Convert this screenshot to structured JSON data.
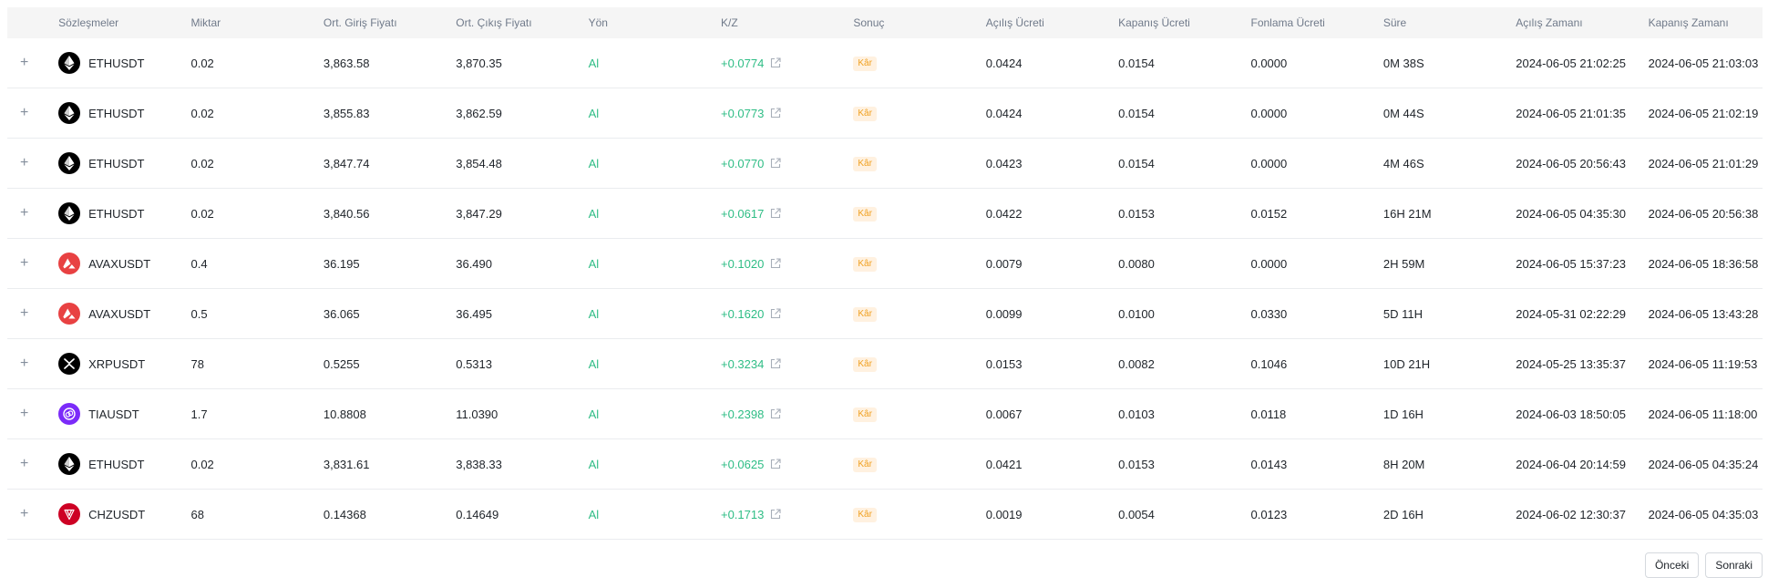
{
  "headers": [
    "Sözleşmeler",
    "Miktar",
    "Ort. Giriş Fiyatı",
    "Ort. Çıkış Fiyatı",
    "Yön",
    "K/Z",
    "Sonuç",
    "Açılış Ücreti",
    "Kapanış Ücreti",
    "Fonlama Ücreti",
    "Süre",
    "Açılış Zamanı",
    "Kapanış Zamanı"
  ],
  "coin_styles": {
    "ETH": {
      "bg": "#000000",
      "icon": "ethereum-icon"
    },
    "AVAX": {
      "bg": "#e84142",
      "icon": "avalanche-icon"
    },
    "XRP": {
      "bg": "#000000",
      "icon": "xrp-icon"
    },
    "TIA": {
      "bg": "#7b2bf9",
      "icon": "celestia-icon"
    },
    "CHZ": {
      "bg": "#cd0124",
      "icon": "chiliz-icon"
    }
  },
  "rows": [
    {
      "coin": "ETH",
      "symbol": "ETHUSDT",
      "qty": "0.02",
      "entry": "3,863.58",
      "exit": "3,870.35",
      "side": "Al",
      "pnl": "+0.0774",
      "result": "Kâr",
      "open_fee": "0.0424",
      "close_fee": "0.0154",
      "funding_fee": "0.0000",
      "duration": "0M 38S",
      "open_time": "2024-06-05 21:02:25",
      "close_time": "2024-06-05 21:03:03"
    },
    {
      "coin": "ETH",
      "symbol": "ETHUSDT",
      "qty": "0.02",
      "entry": "3,855.83",
      "exit": "3,862.59",
      "side": "Al",
      "pnl": "+0.0773",
      "result": "Kâr",
      "open_fee": "0.0424",
      "close_fee": "0.0154",
      "funding_fee": "0.0000",
      "duration": "0M 44S",
      "open_time": "2024-06-05 21:01:35",
      "close_time": "2024-06-05 21:02:19"
    },
    {
      "coin": "ETH",
      "symbol": "ETHUSDT",
      "qty": "0.02",
      "entry": "3,847.74",
      "exit": "3,854.48",
      "side": "Al",
      "pnl": "+0.0770",
      "result": "Kâr",
      "open_fee": "0.0423",
      "close_fee": "0.0154",
      "funding_fee": "0.0000",
      "duration": "4M 46S",
      "open_time": "2024-06-05 20:56:43",
      "close_time": "2024-06-05 21:01:29"
    },
    {
      "coin": "ETH",
      "symbol": "ETHUSDT",
      "qty": "0.02",
      "entry": "3,840.56",
      "exit": "3,847.29",
      "side": "Al",
      "pnl": "+0.0617",
      "result": "Kâr",
      "open_fee": "0.0422",
      "close_fee": "0.0153",
      "funding_fee": "0.0152",
      "duration": "16H 21M",
      "open_time": "2024-06-05 04:35:30",
      "close_time": "2024-06-05 20:56:38"
    },
    {
      "coin": "AVAX",
      "symbol": "AVAXUSDT",
      "qty": "0.4",
      "entry": "36.195",
      "exit": "36.490",
      "side": "Al",
      "pnl": "+0.1020",
      "result": "Kâr",
      "open_fee": "0.0079",
      "close_fee": "0.0080",
      "funding_fee": "0.0000",
      "duration": "2H 59M",
      "open_time": "2024-06-05 15:37:23",
      "close_time": "2024-06-05 18:36:58"
    },
    {
      "coin": "AVAX",
      "symbol": "AVAXUSDT",
      "qty": "0.5",
      "entry": "36.065",
      "exit": "36.495",
      "side": "Al",
      "pnl": "+0.1620",
      "result": "Kâr",
      "open_fee": "0.0099",
      "close_fee": "0.0100",
      "funding_fee": "0.0330",
      "duration": "5D 11H",
      "open_time": "2024-05-31 02:22:29",
      "close_time": "2024-06-05 13:43:28"
    },
    {
      "coin": "XRP",
      "symbol": "XRPUSDT",
      "qty": "78",
      "entry": "0.5255",
      "exit": "0.5313",
      "side": "Al",
      "pnl": "+0.3234",
      "result": "Kâr",
      "open_fee": "0.0153",
      "close_fee": "0.0082",
      "funding_fee": "0.1046",
      "duration": "10D 21H",
      "open_time": "2024-05-25 13:35:37",
      "close_time": "2024-06-05 11:19:53"
    },
    {
      "coin": "TIA",
      "symbol": "TIAUSDT",
      "qty": "1.7",
      "entry": "10.8808",
      "exit": "11.0390",
      "side": "Al",
      "pnl": "+0.2398",
      "result": "Kâr",
      "open_fee": "0.0067",
      "close_fee": "0.0103",
      "funding_fee": "0.0118",
      "duration": "1D 16H",
      "open_time": "2024-06-03 18:50:05",
      "close_time": "2024-06-05 11:18:00"
    },
    {
      "coin": "ETH",
      "symbol": "ETHUSDT",
      "qty": "0.02",
      "entry": "3,831.61",
      "exit": "3,838.33",
      "side": "Al",
      "pnl": "+0.0625",
      "result": "Kâr",
      "open_fee": "0.0421",
      "close_fee": "0.0153",
      "funding_fee": "0.0143",
      "duration": "8H 20M",
      "open_time": "2024-06-04 20:14:59",
      "close_time": "2024-06-05 04:35:24"
    },
    {
      "coin": "CHZ",
      "symbol": "CHZUSDT",
      "qty": "68",
      "entry": "0.14368",
      "exit": "0.14649",
      "side": "Al",
      "pnl": "+0.1713",
      "result": "Kâr",
      "open_fee": "0.0019",
      "close_fee": "0.0054",
      "funding_fee": "0.0123",
      "duration": "2D 16H",
      "open_time": "2024-06-02 12:30:37",
      "close_time": "2024-06-05 04:35:03"
    }
  ],
  "pagination": {
    "prev": "Önceki",
    "next": "Sonraki"
  }
}
